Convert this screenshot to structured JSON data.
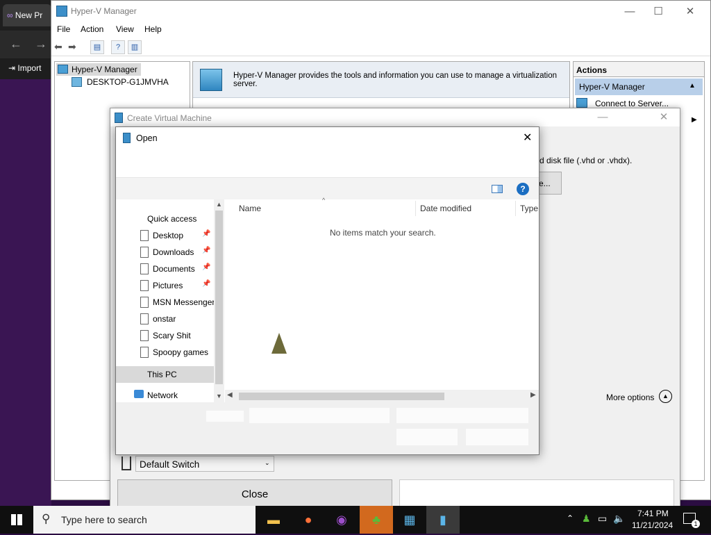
{
  "background_app": {
    "tab_label": "New Pr",
    "import_label": "Import"
  },
  "hyperv": {
    "title": "Hyper-V Manager",
    "menu": [
      "File",
      "Action",
      "View",
      "Help"
    ],
    "tree": {
      "root": "Hyper-V Manager",
      "child": "DESKTOP-G1JMVHA"
    },
    "banner_text": "Hyper-V Manager provides the tools and information you can use to manage a virtualization server.",
    "actions": {
      "header": "Actions",
      "section": "Hyper-V Manager",
      "item1": "Connect to Server..."
    }
  },
  "wizard": {
    "title": "Create Virtual Machine",
    "disk_hint": "rd disk file (.vhd or .vhdx).",
    "browse_partial": "e...",
    "more_options": "More options",
    "switch_value": "Default Switch",
    "close_label": "Close"
  },
  "open_dialog": {
    "title": "Open",
    "columns": {
      "name": "Name",
      "date_modified": "Date modified",
      "type": "Type"
    },
    "empty_message": "No items match your search.",
    "nav": {
      "quick_access": "Quick access",
      "items": [
        {
          "label": "Desktop"
        },
        {
          "label": "Downloads"
        },
        {
          "label": "Documents"
        },
        {
          "label": "Pictures"
        },
        {
          "label": "MSN Messenger"
        },
        {
          "label": "onstar"
        },
        {
          "label": "Scary Shit"
        },
        {
          "label": "Spoopy games"
        }
      ],
      "this_pc": "This PC",
      "network": "Network"
    }
  },
  "taskbar": {
    "search_placeholder": "Type here to search",
    "time": "7:41 PM",
    "date": "11/21/2024",
    "notification_count": "1"
  }
}
